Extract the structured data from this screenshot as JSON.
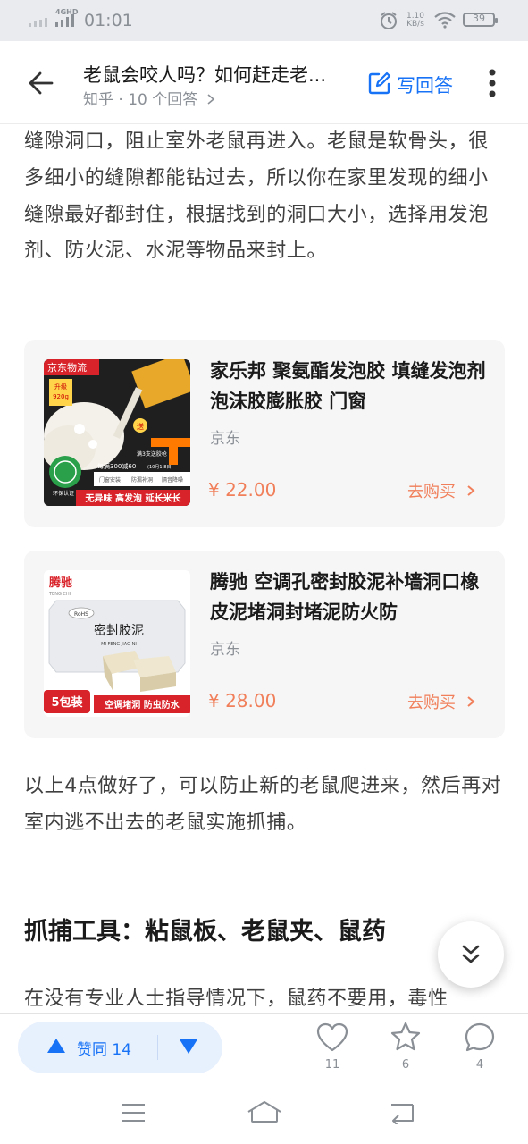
{
  "status_bar": {
    "network": "4GHD",
    "time": "01:01",
    "speed_value": "1.10",
    "speed_unit": "KB/s",
    "battery": "39"
  },
  "header": {
    "title": "老鼠会咬人吗？如何赶走老...",
    "subtitle": "知乎 · 10 个回答",
    "answer_label": "写回答"
  },
  "article": {
    "para1": "缝隙洞口，阻止室外老鼠再进入。老鼠是软骨头，很多细小的缝隙都能钻过去，所以你在家里发现的细小缝隙最好都封住，根据找到的洞口大小，选择用发泡剂、防火泥、水泥等物品来封上。",
    "para2": "以上4点做好了，可以防止新的老鼠爬进来，然后再对室内逃不出去的老鼠实施抓捕。",
    "heading": "抓捕工具：粘鼠板、老鼠夹、鼠药",
    "para3": "在没有专业人士指导情况下，鼠药不要用，毒性"
  },
  "products": [
    {
      "title": "家乐邦 聚氨酯发泡胶 填缝发泡剂泡沫胶膨胀胶 门窗",
      "source": "京东",
      "price": "¥ 22.00",
      "buy_label": "去购买",
      "image": {
        "badge": "京东物流",
        "upgrade": "升级",
        "weight": "920g",
        "gift": "送",
        "gift_line": "满3支送胶枪",
        "promo": "每满300减60",
        "promo_date": "(10月1-8日)",
        "features": [
          "门窗安装",
          "防漏补洞",
          "隔音降噪"
        ],
        "eco": "环保认证",
        "bottom": "无异味 高发泡 延长米长"
      }
    },
    {
      "title": "腾驰 空调孔密封胶泥补墙洞口橡皮泥堵洞封堵泥防火防",
      "source": "京东",
      "price": "¥ 28.00",
      "buy_label": "去购买",
      "image": {
        "brand": "腾驰",
        "brand_en": "TENG CHI",
        "rohs": "RoHS",
        "name": "密封胶泥",
        "pinyin": "MI FENG JIAO NI",
        "pack": "5包装",
        "bottom": "空调堵洞 防虫防水"
      }
    }
  ],
  "bottom_bar": {
    "vote_label": "赞同 14",
    "like_count": "11",
    "favorite_count": "6",
    "comment_count": "4"
  },
  "colors": {
    "accent": "#1772f6",
    "price": "#f07f5a",
    "card_bg": "#f6f6f6",
    "jd_red": "#d9232a"
  }
}
